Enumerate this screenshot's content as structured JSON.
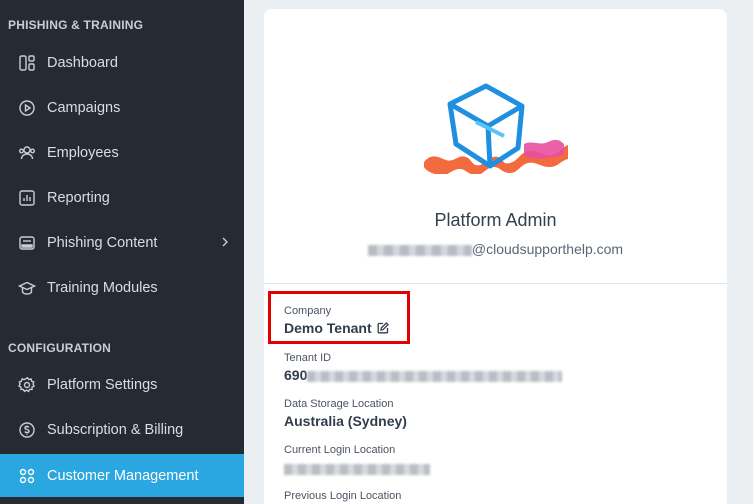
{
  "sidebar": {
    "section_phishing": "PHISHING & TRAINING",
    "section_config": "CONFIGURATION",
    "items": [
      {
        "label": "Dashboard",
        "icon": "dashboard-icon"
      },
      {
        "label": "Campaigns",
        "icon": "play-circle-icon"
      },
      {
        "label": "Employees",
        "icon": "users-icon"
      },
      {
        "label": "Reporting",
        "icon": "bar-chart-icon"
      },
      {
        "label": "Phishing Content",
        "icon": "mail-template-icon"
      },
      {
        "label": "Training Modules",
        "icon": "graduation-cap-icon"
      },
      {
        "label": "Platform Settings",
        "icon": "gear-icon"
      },
      {
        "label": "Subscription & Billing",
        "icon": "dollar-circle-icon"
      },
      {
        "label": "Customer Management",
        "icon": "customers-grid-icon",
        "active": true
      }
    ]
  },
  "profile": {
    "name": "Platform Admin",
    "email_domain": "@cloudsupporthelp.com",
    "company_label": "Company",
    "company_value": "Demo Tenant",
    "tenant_id_label": "Tenant ID",
    "tenant_id_prefix": "690",
    "storage_label": "Data Storage Location",
    "storage_value": "Australia (Sydney)",
    "current_login_label": "Current Login Location",
    "previous_login_label": "Previous Login Location"
  },
  "colors": {
    "sidebar_bg": "#262b33",
    "active_bg": "#2aa6e0",
    "highlight": "#e00000"
  }
}
